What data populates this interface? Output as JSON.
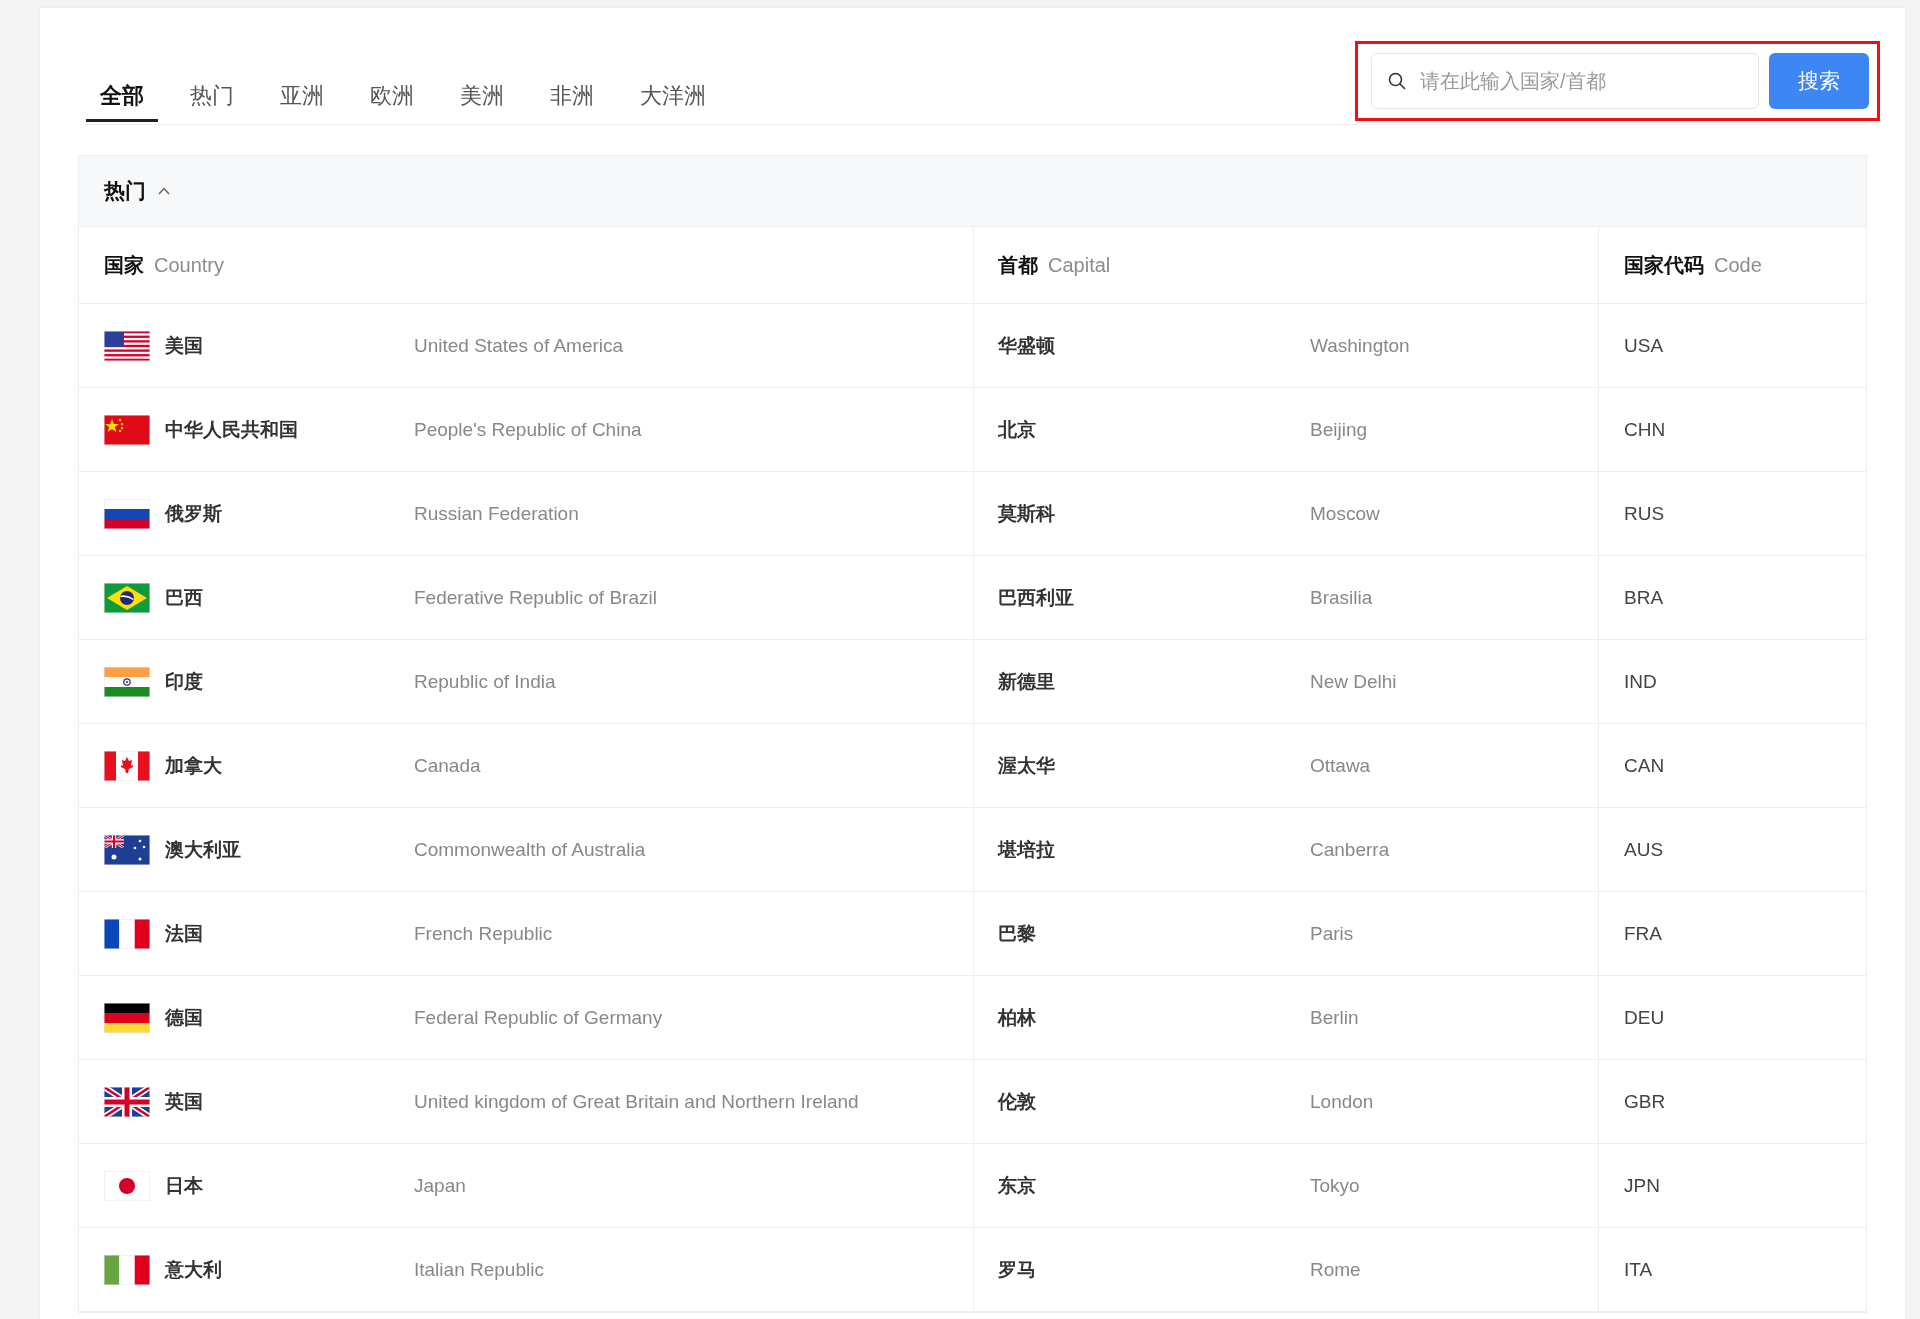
{
  "tabs": [
    {
      "label": "全部",
      "selected": true
    },
    {
      "label": "热门",
      "selected": false
    },
    {
      "label": "亚洲",
      "selected": false
    },
    {
      "label": "欧洲",
      "selected": false
    },
    {
      "label": "美洲",
      "selected": false
    },
    {
      "label": "非洲",
      "selected": false
    },
    {
      "label": "大洋洲",
      "selected": false
    }
  ],
  "search": {
    "placeholder": "请在此输入国家/首都",
    "button": "搜索"
  },
  "section": {
    "title": "热门",
    "expanded": true,
    "columns": [
      {
        "zh": "国家",
        "en": "Country"
      },
      {
        "zh": "首都",
        "en": "Capital"
      },
      {
        "zh": "国家代码",
        "en": "Code"
      }
    ],
    "rows": [
      {
        "kind": "usa",
        "name_zh": "美国",
        "name_en": "United States of America",
        "capital_zh": "华盛顿",
        "capital_en": "Washington",
        "code": "USA"
      },
      {
        "kind": "china",
        "name_zh": "中华人民共和国",
        "name_en": "People's Republic of China",
        "capital_zh": "北京",
        "capital_en": "Beijing",
        "code": "CHN"
      },
      {
        "kind": "russia",
        "name_zh": "俄罗斯",
        "name_en": "Russian Federation",
        "capital_zh": "莫斯科",
        "capital_en": "Moscow",
        "code": "RUS"
      },
      {
        "kind": "brazil",
        "name_zh": "巴西",
        "name_en": "Federative Republic of Brazil",
        "capital_zh": "巴西利亚",
        "capital_en": "Brasilia",
        "code": "BRA"
      },
      {
        "kind": "india",
        "name_zh": "印度",
        "name_en": "Republic of India",
        "capital_zh": "新德里",
        "capital_en": "New Delhi",
        "code": "IND"
      },
      {
        "kind": "canada",
        "name_zh": "加拿大",
        "name_en": "Canada",
        "capital_zh": "渥太华",
        "capital_en": "Ottawa",
        "code": "CAN"
      },
      {
        "kind": "australia",
        "name_zh": "澳大利亚",
        "name_en": "Commonwealth of Australia",
        "capital_zh": "堪培拉",
        "capital_en": "Canberra",
        "code": "AUS"
      },
      {
        "kind": "france",
        "name_zh": "法国",
        "name_en": "French Republic",
        "capital_zh": "巴黎",
        "capital_en": "Paris",
        "code": "FRA"
      },
      {
        "kind": "germany",
        "name_zh": "德国",
        "name_en": "Federal Republic of Germany",
        "capital_zh": "柏林",
        "capital_en": "Berlin",
        "code": "DEU"
      },
      {
        "kind": "uk",
        "name_zh": "英国",
        "name_en": "United kingdom of Great Britain and Northern Ireland",
        "capital_zh": "伦敦",
        "capital_en": "London",
        "code": "GBR"
      },
      {
        "kind": "japan",
        "name_zh": "日本",
        "name_en": "Japan",
        "capital_zh": "东京",
        "capital_en": "Tokyo",
        "code": "JPN"
      },
      {
        "kind": "italy",
        "name_zh": "意大利",
        "name_en": "Italian Republic",
        "capital_zh": "罗马",
        "capital_en": "Rome",
        "code": "ITA"
      }
    ]
  }
}
